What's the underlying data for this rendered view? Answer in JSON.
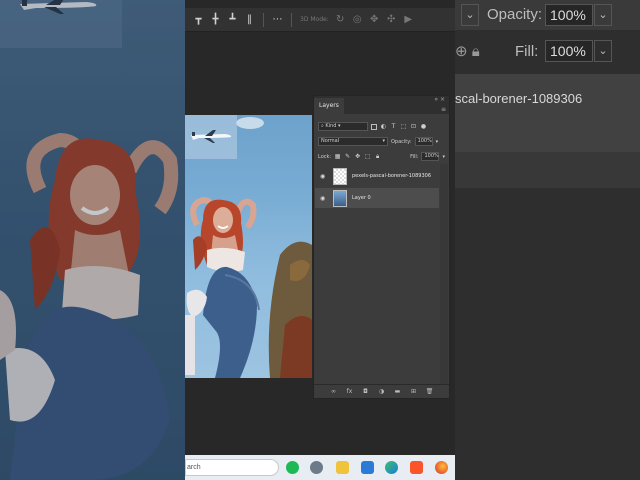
{
  "app": "Photoshop",
  "options_bar": {
    "mode_label": "3D Mode:"
  },
  "background_right": {
    "opacity_label": "Opacity:",
    "opacity_value": "100%",
    "fill_label": "Fill:",
    "fill_value": "100%",
    "layer_name_partial": "scal-borener-1089306"
  },
  "layers_panel": {
    "tab_label": "Layers",
    "close_glyph": "»",
    "close_x": "×",
    "menu_glyph": "≡",
    "filter_value": "Kind",
    "blend_mode": "Normal",
    "opacity_label": "Opacity:",
    "opacity_value": "100%",
    "lock_label": "Lock:",
    "fill_label": "Fill:",
    "fill_value": "100%",
    "layers": [
      {
        "name": "pexels-pascal-borener-1089306",
        "visible": true,
        "selected": false
      },
      {
        "name": "Layer 0",
        "visible": true,
        "selected": true
      }
    ]
  },
  "taskbar": {
    "search_text": "arch",
    "apps": [
      "spotify-icon",
      "settings-icon",
      "file-explorer-icon",
      "store-icon",
      "edge-icon",
      "brave-icon",
      "firefox-icon"
    ]
  },
  "colors": {
    "panel_bg": "#3c3c3c",
    "selected_row": "#4d4d4d",
    "sky": "#79acd3",
    "hair": "#b8462a",
    "denim": "#3d5f8c"
  }
}
